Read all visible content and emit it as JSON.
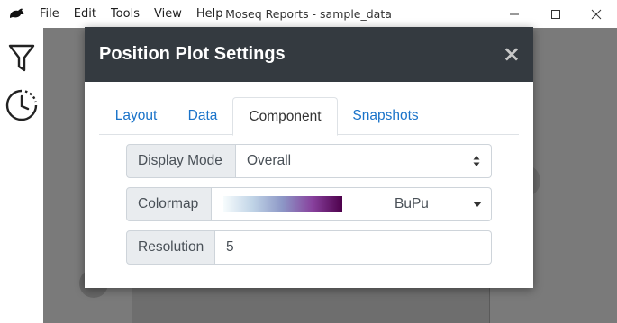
{
  "window": {
    "title": "Moseq Reports - sample_data",
    "menu": [
      "File",
      "Edit",
      "Tools",
      "View",
      "Help"
    ]
  },
  "sidebar": {
    "icons": [
      "filter-icon",
      "history-icon"
    ]
  },
  "modal": {
    "title": "Position Plot Settings",
    "close_label": "×",
    "tabs": [
      {
        "label": "Layout",
        "active": false
      },
      {
        "label": "Data",
        "active": false
      },
      {
        "label": "Component",
        "active": true
      },
      {
        "label": "Snapshots",
        "active": false
      }
    ],
    "fields": {
      "display_mode": {
        "label": "Display Mode",
        "value": "Overall"
      },
      "colormap": {
        "label": "Colormap",
        "value": "BuPu"
      },
      "resolution": {
        "label": "Resolution",
        "value": "5"
      }
    }
  },
  "colors": {
    "modal_header": "#343a40",
    "tab_link": "#1a73c9",
    "backdrop": "#7a7a7a"
  }
}
